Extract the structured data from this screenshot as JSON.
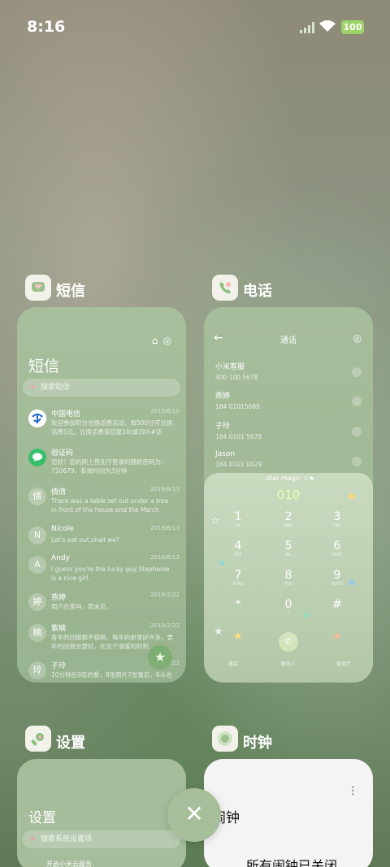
{
  "status": {
    "time": "8:16",
    "battery": "100"
  },
  "apps": [
    {
      "name": "短信"
    },
    {
      "name": "电话"
    },
    {
      "name": "设置"
    },
    {
      "name": "时钟"
    }
  ],
  "sms": {
    "title": "短信",
    "search_placeholder": "搜索短信",
    "rows": [
      {
        "avatar": "",
        "name": "中国电信",
        "date": "2019/6/10",
        "snippet": "欢迎参加积分兑换话费活动，每500分可兑换话费5元。兑换话费请回复10(或)Sth#话费..."
      },
      {
        "avatar": "",
        "name": "验证码",
        "date": "",
        "snippet": "您好！您的网上营业厅登录的随机密码为：710679，有效时间为3分钟"
      },
      {
        "avatar": "倩",
        "name": "倩倩",
        "date": "2019/6/13",
        "snippet": "There was a table set out under a tree in front of the house,and the March Hare we"
      },
      {
        "avatar": "N",
        "name": "Nicole",
        "date": "2019/6/13",
        "snippet": "Let's eat out,shall we?"
      },
      {
        "avatar": "A",
        "name": "Andy",
        "date": "2019/6/13",
        "snippet": "I guess you're the lucky guy,Stephanie is a nice girl."
      },
      {
        "avatar": "婷",
        "name": "燕婷",
        "date": "2019/2/22",
        "snippet": "周六在家吗，周末见。"
      },
      {
        "avatar": "楠",
        "name": "紫楠",
        "date": "2019/2/22",
        "snippet": "各年的回报都不错啊，每年的新里好许多，要年的回报会更好，在这个温暖的时刻"
      },
      {
        "avatar": "玲",
        "name": "子玲",
        "date": "2019/2/22",
        "snippet": "10分钟后9层的餐，8张照片7张重启，6斗亦"
      }
    ]
  },
  "phone": {
    "title": "通话",
    "contacts": [
      {
        "name": "小米客服",
        "number": "400 100 5678"
      },
      {
        "name": "燕婷",
        "number": "184 01015689"
      },
      {
        "name": "子玲",
        "number": "184 0101 5678"
      },
      {
        "name": "Jason",
        "number": "184 0101 0029"
      }
    ],
    "dial_brand": "·.star magic ☆★",
    "dial_number": "010",
    "keys": [
      {
        "digit": "1",
        "letters": "oo"
      },
      {
        "digit": "2",
        "letters": "ABC"
      },
      {
        "digit": "3",
        "letters": "DEF"
      },
      {
        "digit": "4",
        "letters": "GHI"
      },
      {
        "digit": "5",
        "letters": "JKL"
      },
      {
        "digit": "6",
        "letters": "MNO"
      },
      {
        "digit": "7",
        "letters": "PQRS"
      },
      {
        "digit": "8",
        "letters": "TUV"
      },
      {
        "digit": "9",
        "letters": "WXYZ"
      },
      {
        "digit": "*",
        "letters": ""
      },
      {
        "digit": "0",
        "letters": "+"
      },
      {
        "digit": "#",
        "letters": ""
      }
    ],
    "tabs": [
      "通话",
      "联系人",
      "营业厅"
    ]
  },
  "settings": {
    "title": "设置",
    "search_placeholder": "搜索系统设置项",
    "first_item": "开启小米云服务"
  },
  "clock": {
    "title": "闹钟",
    "empty_text": "所有闹钟已关闭"
  },
  "close_icon": "✕"
}
